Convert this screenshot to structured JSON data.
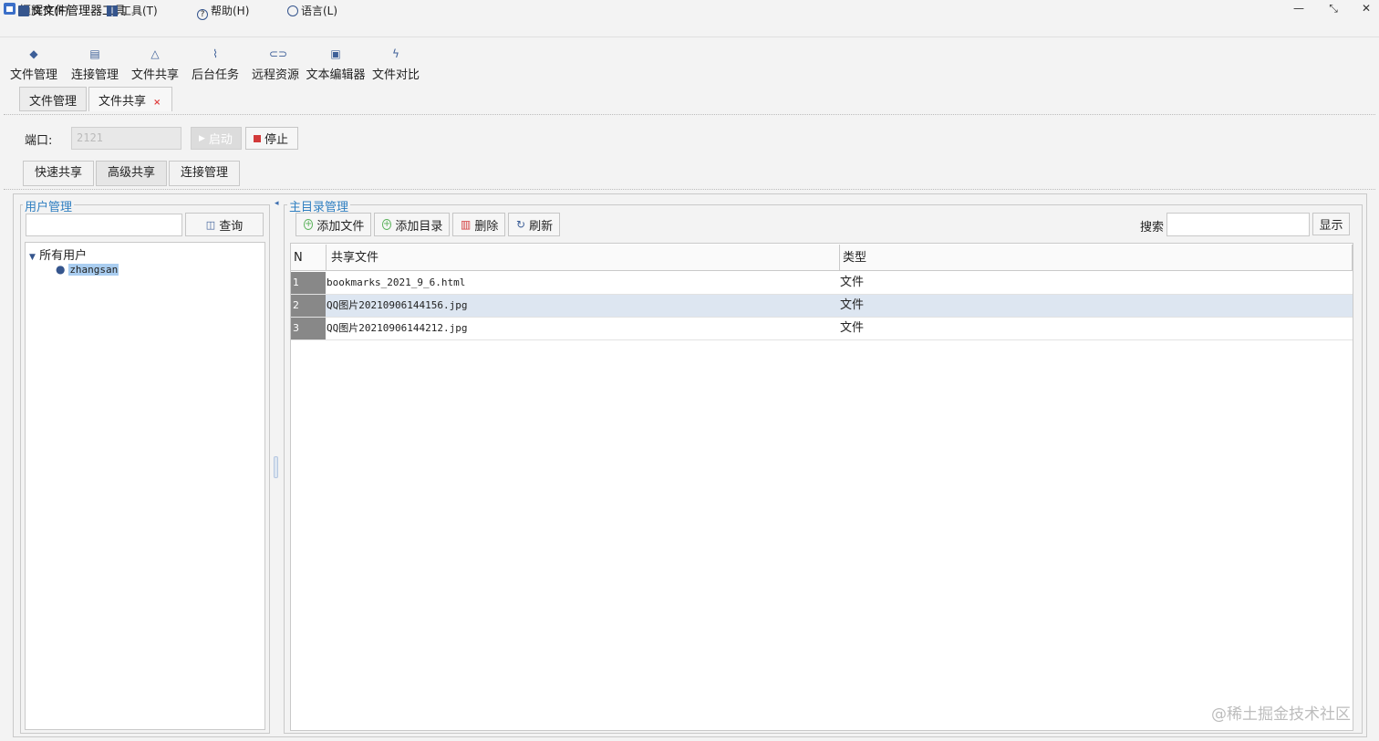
{
  "window": {
    "title": "恒辉文件管理器工具",
    "minimize": "—",
    "restore": "⤡",
    "close": "✕"
  },
  "menu": [
    {
      "label": "文件(F)",
      "icon": "file-icon"
    },
    {
      "label": "工具(T)",
      "icon": "grid-icon"
    },
    {
      "label": "帮助(H)",
      "icon": "help-icon"
    },
    {
      "label": "语言(L)",
      "icon": "globe-icon"
    }
  ],
  "toolbar": [
    {
      "label": "文件管理",
      "icon": "layers-icon"
    },
    {
      "label": "连接管理",
      "icon": "code-icon"
    },
    {
      "label": "文件共享",
      "icon": "share-icon"
    },
    {
      "label": "后台任务",
      "icon": "chart-icon"
    },
    {
      "label": "远程资源",
      "icon": "link-icon"
    },
    {
      "label": "文本编辑器",
      "icon": "editor-icon"
    },
    {
      "label": "文件对比",
      "icon": "bolt-icon"
    }
  ],
  "doc_tabs": [
    {
      "label": "文件管理"
    },
    {
      "label": "文件共享",
      "close": "×"
    }
  ],
  "port": {
    "label": "端口:",
    "value": "2121",
    "start": "启动",
    "stop": "停止"
  },
  "share_tabs": [
    "快速共享",
    "高级共享",
    "连接管理"
  ],
  "user_panel": {
    "title": "用户管理",
    "query": "查询",
    "root": "所有用户",
    "user": "zhangsan"
  },
  "dir_panel": {
    "title": "主目录管理",
    "add_file": "添加文件",
    "add_dir": "添加目录",
    "delete": "删除",
    "refresh": "刷新",
    "search_label": "搜索",
    "show": "显示",
    "columns": [
      "N",
      "共享文件",
      "类型"
    ],
    "rows": [
      {
        "n": "1",
        "file": "bookmarks_2021_9_6.html",
        "type": "文件"
      },
      {
        "n": "2",
        "file": "QQ图片20210906144156.jpg",
        "type": "文件"
      },
      {
        "n": "3",
        "file": "QQ图片20210906144212.jpg",
        "type": "文件"
      }
    ]
  },
  "watermark": "@稀土掘金技术社区"
}
